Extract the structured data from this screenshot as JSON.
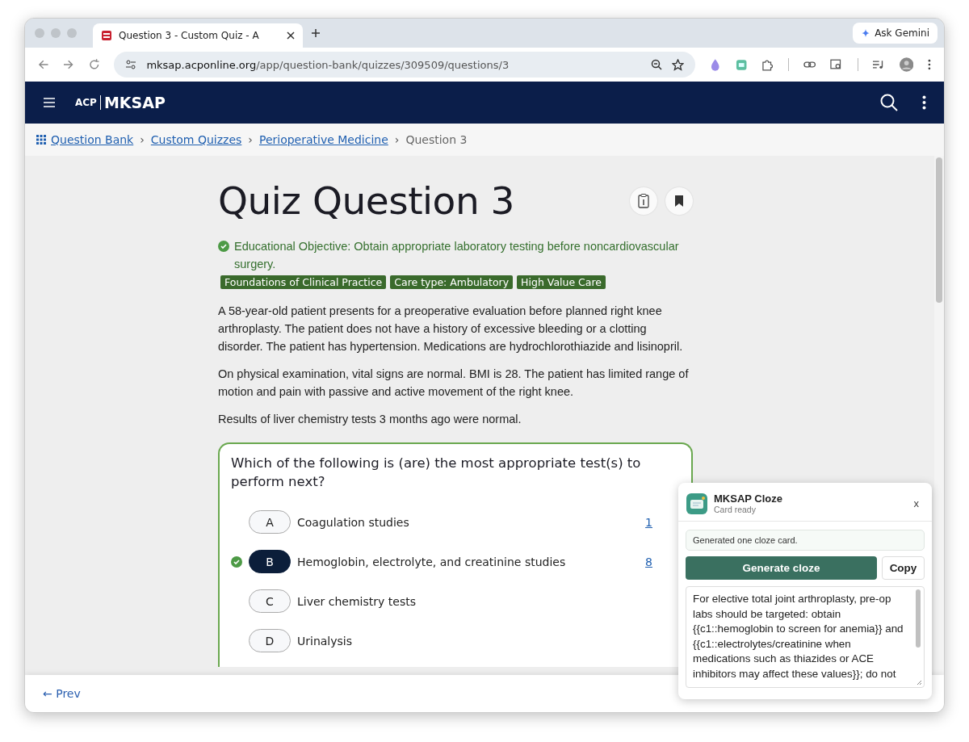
{
  "browser": {
    "tab_title": "Question 3 - Custom Quiz - A",
    "ask_button": "Ask Gemini",
    "url_host": "mksap.acponline.org",
    "url_path": "/app/question-bank/quizzes/309509/questions/3"
  },
  "header": {
    "logo_small": "ACP",
    "logo_main": "MKSAP"
  },
  "breadcrumb": {
    "links": [
      "Question Bank",
      "Custom Quizzes",
      "Perioperative Medicine"
    ],
    "separators": [
      "›",
      "›",
      "›"
    ],
    "current": "Question 3"
  },
  "title": "Quiz Question 3",
  "objective": "Educational Objective: Obtain appropriate laboratory testing before noncardiovascular surgery.",
  "tags": [
    "Foundations of Clinical Practice",
    "Care type: Ambulatory",
    "High Value Care"
  ],
  "paragraphs": [
    "A 58-year-old patient presents for a preoperative evaluation before planned right knee arthroplasty. The patient does not have a history of excessive bleeding or a clotting disorder. The patient has hypertension. Medications are hydrochlorothiazide and lisinopril.",
    "On physical examination, vital signs are normal. BMI is 28. The patient has limited range of motion and pain with passive and active movement of the right knee.",
    "Results of liver chemistry tests 3 months ago were normal."
  ],
  "question": "Which of the following is (are) the most appropriate test(s) to perform next?",
  "options": [
    {
      "letter": "A",
      "text": "Coagulation studies",
      "selected": false,
      "correct": false,
      "percent": "1"
    },
    {
      "letter": "B",
      "text": "Hemoglobin, electrolyte, and creatinine studies",
      "selected": true,
      "correct": true,
      "percent": "8"
    },
    {
      "letter": "C",
      "text": "Liver chemistry tests",
      "selected": false,
      "correct": false
    },
    {
      "letter": "D",
      "text": "Urinalysis",
      "selected": false,
      "correct": false
    }
  ],
  "footer": {
    "prev": "← Prev"
  },
  "popup": {
    "title": "MKSAP Cloze",
    "status": "Card ready",
    "close": "x",
    "message": "Generated one cloze card.",
    "generate": "Generate cloze",
    "copy": "Copy",
    "card_text": "For elective total joint arthroplasty, pre-op labs should be targeted: obtain {{c1::hemoglobin to screen for anemia}} and {{c1::electrolytes/creatinine when medications such as thiazides or ACE inhibitors may affect these values}}; do not"
  }
}
